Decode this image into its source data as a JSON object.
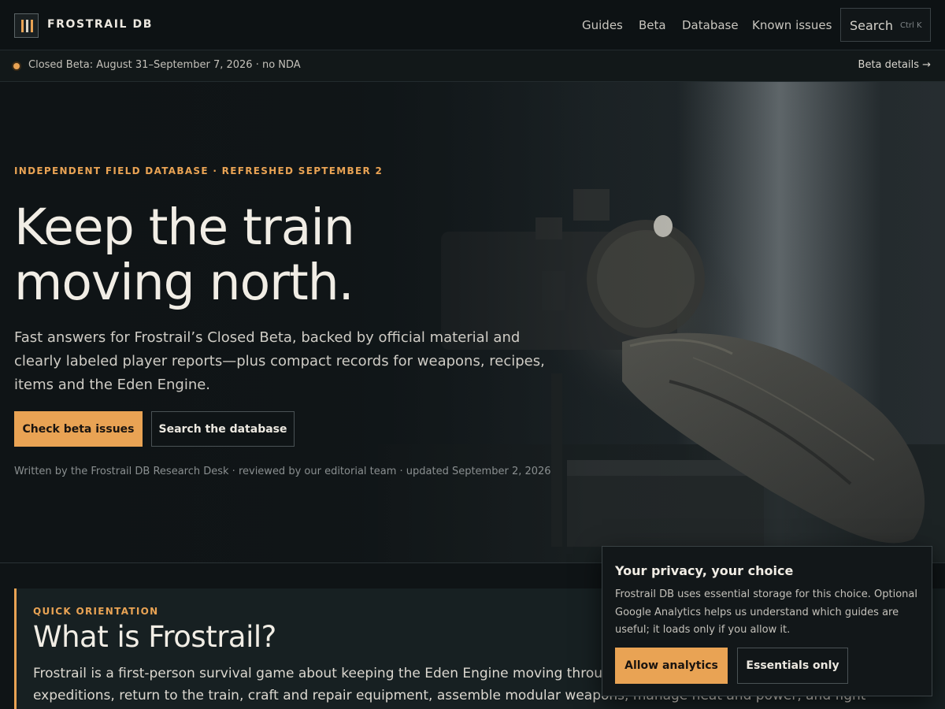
{
  "header": {
    "brand": "FROSTRAIL DB",
    "nav": [
      "Guides",
      "Beta",
      "Database",
      "Known issues"
    ],
    "search_label": "Search",
    "search_shortcut": "Ctrl K"
  },
  "beta_strip": {
    "text": "Closed Beta: August 31–September 7, 2026 · no NDA",
    "link": "Beta details →",
    "accent": "#e9a354"
  },
  "hero": {
    "eyebrow": "INDEPENDENT FIELD DATABASE · REFRESHED SEPTEMBER 2",
    "title_line1": "Keep the train",
    "title_line2": "moving north.",
    "lede": "Fast answers for Frostrail’s Closed Beta, backed by official material and clearly labeled player reports—plus compact records for weapons, recipes, items and the Eden Engine.",
    "primary_cta": "Check beta issues",
    "secondary_cta": "Search the database",
    "byline": "Written by the Frostrail DB Research Desk · reviewed by our editorial team · updated September 2, 2026"
  },
  "orientation": {
    "kicker": "QUICK ORIENTATION",
    "title": "What is Frostrail?",
    "body": "Frostrail is a first-person survival game about keeping the Eden Engine moving through a frozen wasteland. You scavenge on expeditions, return to the train, craft and repair equipment, assemble modular weapons, manage heat and power, and fight Revenants while the"
  },
  "privacy": {
    "title": "Your privacy, your choice",
    "body": "Frostrail DB uses essential storage for this choice. Optional Google Analytics helps us understand which guides are useful; it loads only if you allow it.",
    "allow": "Allow analytics",
    "essentials": "Essentials only"
  },
  "colors": {
    "accent": "#e9a354",
    "background": "#0f1416",
    "card": "#172022"
  }
}
